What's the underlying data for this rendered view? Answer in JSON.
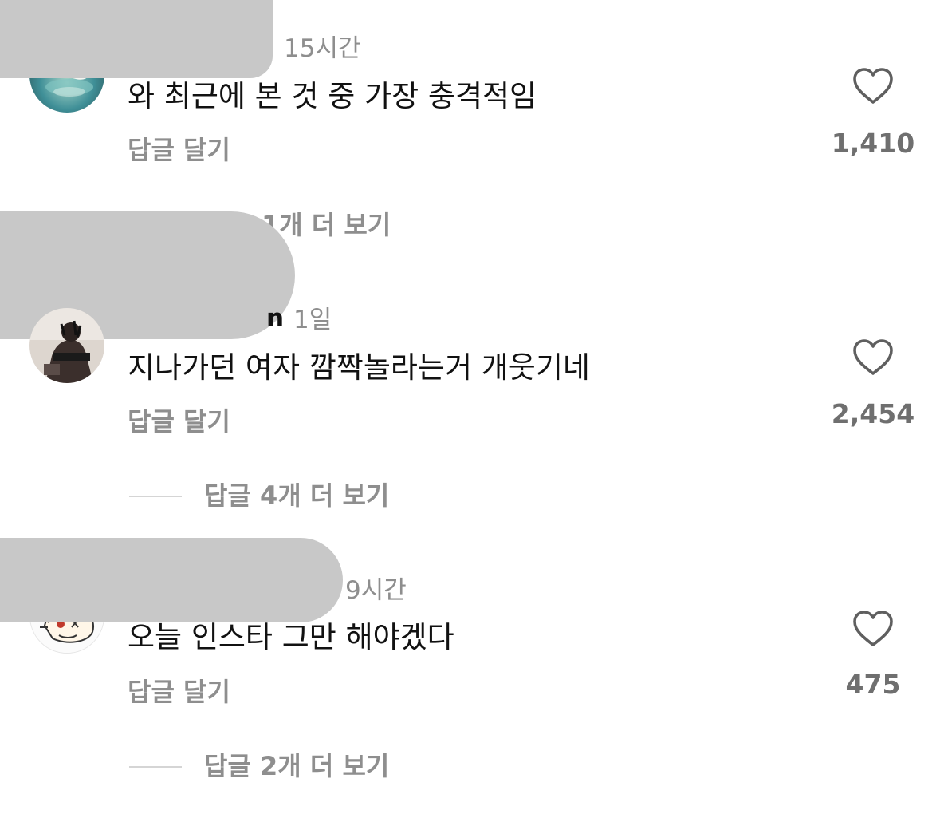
{
  "colors": {
    "text": "#111111",
    "secondary": "#8e8e8e",
    "like_count": "#6f6f6f",
    "redaction": "#c8c8c8",
    "divider": "#d5d5d5"
  },
  "comments": [
    {
      "time": "15시간",
      "text": "와 최근에 본 것 중 가장 충격적임",
      "reply_label": "답글 달기",
      "likes": "1,410",
      "view_more": "1개 더 보기",
      "avatar_icon": "avatar-water-bird"
    },
    {
      "username_partial": "n",
      "time": "1일",
      "text": "지나가던 여자 깜짝놀라는거 개웃기네",
      "reply_label": "답글 달기",
      "likes": "2,454",
      "view_more": "답글 4개 더 보기",
      "avatar_icon": "avatar-person-photo"
    },
    {
      "time": "9시간",
      "text": "오늘 인스타 그만 해야겠다",
      "reply_label": "답글 달기",
      "likes": "475",
      "view_more": "답글 2개 더 보기",
      "avatar_icon": "avatar-cartoon-character"
    }
  ]
}
